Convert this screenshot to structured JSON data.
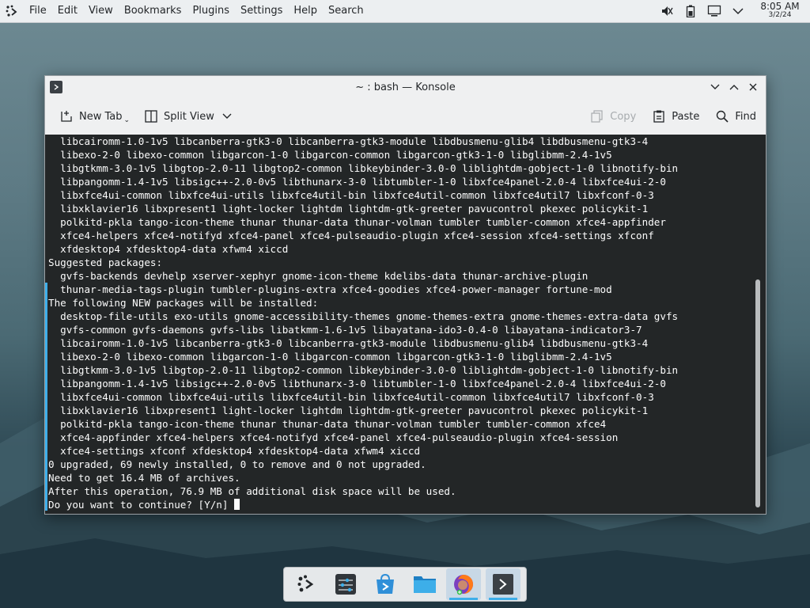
{
  "topbar": {
    "menus": [
      "File",
      "Edit",
      "View",
      "Bookmarks",
      "Plugins",
      "Settings",
      "Help",
      "Search"
    ],
    "clock_time": "8:05 AM",
    "clock_date": "3/2/24",
    "icons": [
      "kde-launcher-icon",
      "volume-muted-icon",
      "battery-icon",
      "network-icon",
      "tray-expand-icon"
    ]
  },
  "window": {
    "title": "~ : bash — Konsole",
    "toolbar": {
      "new_tab": "New Tab",
      "split_view": "Split View",
      "copy": "Copy",
      "paste": "Paste",
      "find": "Find"
    }
  },
  "terminal": {
    "lines": [
      "  libcairomm-1.0-1v5 libcanberra-gtk3-0 libcanberra-gtk3-module libdbusmenu-glib4 libdbusmenu-gtk3-4",
      "  libexo-2-0 libexo-common libgarcon-1-0 libgarcon-common libgarcon-gtk3-1-0 libglibmm-2.4-1v5",
      "  libgtkmm-3.0-1v5 libgtop-2.0-11 libgtop2-common libkeybinder-3.0-0 liblightdm-gobject-1-0 libnotify-bin",
      "  libpangomm-1.4-1v5 libsigc++-2.0-0v5 libthunarx-3-0 libtumbler-1-0 libxfce4panel-2.0-4 libxfce4ui-2-0",
      "  libxfce4ui-common libxfce4ui-utils libxfce4util-bin libxfce4util-common libxfce4util7 libxfconf-0-3",
      "  libxklavier16 libxpresent1 light-locker lightdm lightdm-gtk-greeter pavucontrol pkexec policykit-1",
      "  polkitd-pkla tango-icon-theme thunar thunar-data thunar-volman tumbler tumbler-common xfce4-appfinder",
      "  xfce4-helpers xfce4-notifyd xfce4-panel xfce4-pulseaudio-plugin xfce4-session xfce4-settings xfconf",
      "  xfdesktop4 xfdesktop4-data xfwm4 xiccd",
      "Suggested packages:",
      "  gvfs-backends devhelp xserver-xephyr gnome-icon-theme kdelibs-data thunar-archive-plugin",
      "  thunar-media-tags-plugin tumbler-plugins-extra xfce4-goodies xfce4-power-manager fortune-mod",
      "The following NEW packages will be installed:",
      "  desktop-file-utils exo-utils gnome-accessibility-themes gnome-themes-extra gnome-themes-extra-data gvfs",
      "  gvfs-common gvfs-daemons gvfs-libs libatkmm-1.6-1v5 libayatana-ido3-0.4-0 libayatana-indicator3-7",
      "  libcairomm-1.0-1v5 libcanberra-gtk3-0 libcanberra-gtk3-module libdbusmenu-glib4 libdbusmenu-gtk3-4",
      "  libexo-2-0 libexo-common libgarcon-1-0 libgarcon-common libgarcon-gtk3-1-0 libglibmm-2.4-1v5",
      "  libgtkmm-3.0-1v5 libgtop-2.0-11 libgtop2-common libkeybinder-3.0-0 liblightdm-gobject-1-0 libnotify-bin",
      "  libpangomm-1.4-1v5 libsigc++-2.0-0v5 libthunarx-3-0 libtumbler-1-0 libxfce4panel-2.0-4 libxfce4ui-2-0",
      "  libxfce4ui-common libxfce4ui-utils libxfce4util-bin libxfce4util-common libxfce4util7 libxfconf-0-3",
      "  libxklavier16 libxpresent1 light-locker lightdm lightdm-gtk-greeter pavucontrol pkexec policykit-1",
      "  polkitd-pkla tango-icon-theme thunar thunar-data thunar-volman tumbler tumbler-common xfce4",
      "  xfce4-appfinder xfce4-helpers xfce4-notifyd xfce4-panel xfce4-pulseaudio-plugin xfce4-session",
      "  xfce4-settings xfconf xfdesktop4 xfdesktop4-data xfwm4 xiccd",
      "0 upgraded, 69 newly installed, 0 to remove and 0 not upgraded.",
      "Need to get 16.4 MB of archives.",
      "After this operation, 76.9 MB of additional disk space will be used.",
      "Do you want to continue? [Y/n] "
    ]
  },
  "taskbar": {
    "items": [
      "kde-launcher-icon",
      "system-settings-icon",
      "discover-store-icon",
      "file-manager-icon",
      "firefox-icon",
      "konsole-icon"
    ]
  },
  "colors": {
    "terminal_bg": "#232627",
    "terminal_fg": "#fcfcfc",
    "accent": "#3daee9"
  }
}
